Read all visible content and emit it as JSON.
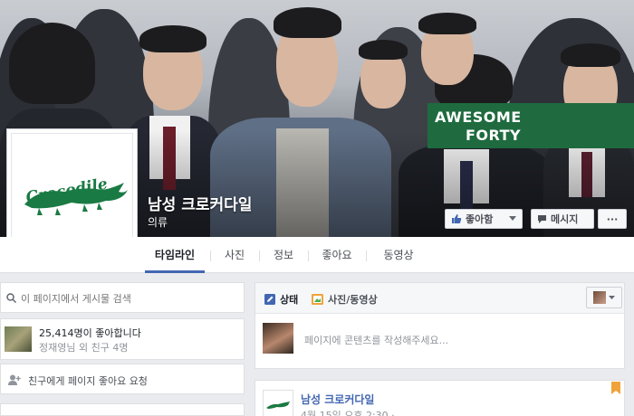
{
  "cover": {
    "banner_line1": "AWESOME",
    "banner_line2": "FORTY",
    "banner_color": "#1f6b3f"
  },
  "page": {
    "name": "남성 크로커다일",
    "category": "의류",
    "logo_text": "Crocodile"
  },
  "actions": {
    "like": "좋아함",
    "message": "메시지",
    "more": "···"
  },
  "tabs": [
    "타임라인",
    "사진",
    "정보",
    "좋아요",
    "동영상"
  ],
  "sidebar": {
    "search_placeholder": "이 페이지에서 게시물 검색",
    "likes_count": "25,414명이 좋아합니다",
    "likes_friends": "정재영님 외 친구 4명",
    "invite": "친구에게 페이지 좋아요 요청"
  },
  "composer": {
    "status_tab": "상태",
    "photo_tab": "사진/동영상",
    "placeholder": "페이지에 콘텐츠를 작성해주세요..."
  },
  "post": {
    "author": "남성 크로커다일",
    "date": "4월 15일 오후 2:30 · "
  },
  "icons": [
    "search-icon",
    "avatar-icon",
    "add-friend-icon",
    "thumbs-up-icon",
    "message-icon",
    "pencil-icon",
    "camera-icon",
    "dropdown-icon",
    "bookmark-icon"
  ],
  "colors": {
    "accent": "#4267b2",
    "banner": "#1f6b3f",
    "background": "#e9ebee"
  }
}
